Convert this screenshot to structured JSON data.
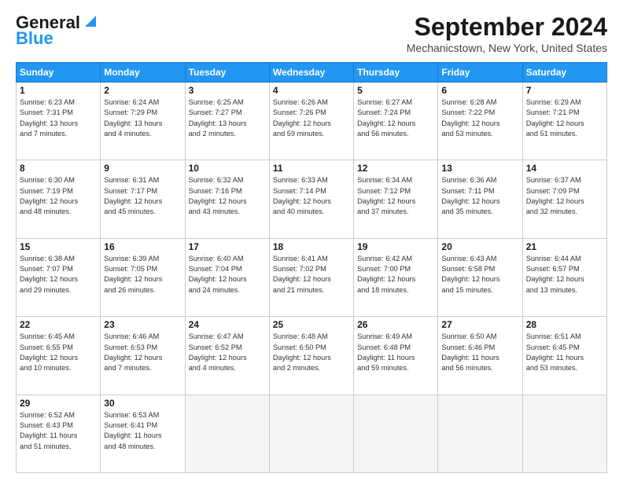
{
  "logo": {
    "line1": "General",
    "line2": "Blue"
  },
  "title": "September 2024",
  "subtitle": "Mechanicstown, New York, United States",
  "weekdays": [
    "Sunday",
    "Monday",
    "Tuesday",
    "Wednesday",
    "Thursday",
    "Friday",
    "Saturday"
  ],
  "weeks": [
    [
      {
        "day": "1",
        "info": "Sunrise: 6:23 AM\nSunset: 7:31 PM\nDaylight: 13 hours\nand 7 minutes."
      },
      {
        "day": "2",
        "info": "Sunrise: 6:24 AM\nSunset: 7:29 PM\nDaylight: 13 hours\nand 4 minutes."
      },
      {
        "day": "3",
        "info": "Sunrise: 6:25 AM\nSunset: 7:27 PM\nDaylight: 13 hours\nand 2 minutes."
      },
      {
        "day": "4",
        "info": "Sunrise: 6:26 AM\nSunset: 7:26 PM\nDaylight: 12 hours\nand 59 minutes."
      },
      {
        "day": "5",
        "info": "Sunrise: 6:27 AM\nSunset: 7:24 PM\nDaylight: 12 hours\nand 56 minutes."
      },
      {
        "day": "6",
        "info": "Sunrise: 6:28 AM\nSunset: 7:22 PM\nDaylight: 12 hours\nand 53 minutes."
      },
      {
        "day": "7",
        "info": "Sunrise: 6:29 AM\nSunset: 7:21 PM\nDaylight: 12 hours\nand 51 minutes."
      }
    ],
    [
      {
        "day": "8",
        "info": "Sunrise: 6:30 AM\nSunset: 7:19 PM\nDaylight: 12 hours\nand 48 minutes."
      },
      {
        "day": "9",
        "info": "Sunrise: 6:31 AM\nSunset: 7:17 PM\nDaylight: 12 hours\nand 45 minutes."
      },
      {
        "day": "10",
        "info": "Sunrise: 6:32 AM\nSunset: 7:16 PM\nDaylight: 12 hours\nand 43 minutes."
      },
      {
        "day": "11",
        "info": "Sunrise: 6:33 AM\nSunset: 7:14 PM\nDaylight: 12 hours\nand 40 minutes."
      },
      {
        "day": "12",
        "info": "Sunrise: 6:34 AM\nSunset: 7:12 PM\nDaylight: 12 hours\nand 37 minutes."
      },
      {
        "day": "13",
        "info": "Sunrise: 6:36 AM\nSunset: 7:11 PM\nDaylight: 12 hours\nand 35 minutes."
      },
      {
        "day": "14",
        "info": "Sunrise: 6:37 AM\nSunset: 7:09 PM\nDaylight: 12 hours\nand 32 minutes."
      }
    ],
    [
      {
        "day": "15",
        "info": "Sunrise: 6:38 AM\nSunset: 7:07 PM\nDaylight: 12 hours\nand 29 minutes."
      },
      {
        "day": "16",
        "info": "Sunrise: 6:39 AM\nSunset: 7:05 PM\nDaylight: 12 hours\nand 26 minutes."
      },
      {
        "day": "17",
        "info": "Sunrise: 6:40 AM\nSunset: 7:04 PM\nDaylight: 12 hours\nand 24 minutes."
      },
      {
        "day": "18",
        "info": "Sunrise: 6:41 AM\nSunset: 7:02 PM\nDaylight: 12 hours\nand 21 minutes."
      },
      {
        "day": "19",
        "info": "Sunrise: 6:42 AM\nSunset: 7:00 PM\nDaylight: 12 hours\nand 18 minutes."
      },
      {
        "day": "20",
        "info": "Sunrise: 6:43 AM\nSunset: 6:58 PM\nDaylight: 12 hours\nand 15 minutes."
      },
      {
        "day": "21",
        "info": "Sunrise: 6:44 AM\nSunset: 6:57 PM\nDaylight: 12 hours\nand 13 minutes."
      }
    ],
    [
      {
        "day": "22",
        "info": "Sunrise: 6:45 AM\nSunset: 6:55 PM\nDaylight: 12 hours\nand 10 minutes."
      },
      {
        "day": "23",
        "info": "Sunrise: 6:46 AM\nSunset: 6:53 PM\nDaylight: 12 hours\nand 7 minutes."
      },
      {
        "day": "24",
        "info": "Sunrise: 6:47 AM\nSunset: 6:52 PM\nDaylight: 12 hours\nand 4 minutes."
      },
      {
        "day": "25",
        "info": "Sunrise: 6:48 AM\nSunset: 6:50 PM\nDaylight: 12 hours\nand 2 minutes."
      },
      {
        "day": "26",
        "info": "Sunrise: 6:49 AM\nSunset: 6:48 PM\nDaylight: 11 hours\nand 59 minutes."
      },
      {
        "day": "27",
        "info": "Sunrise: 6:50 AM\nSunset: 6:46 PM\nDaylight: 11 hours\nand 56 minutes."
      },
      {
        "day": "28",
        "info": "Sunrise: 6:51 AM\nSunset: 6:45 PM\nDaylight: 11 hours\nand 53 minutes."
      }
    ],
    [
      {
        "day": "29",
        "info": "Sunrise: 6:52 AM\nSunset: 6:43 PM\nDaylight: 11 hours\nand 51 minutes."
      },
      {
        "day": "30",
        "info": "Sunrise: 6:53 AM\nSunset: 6:41 PM\nDaylight: 11 hours\nand 48 minutes."
      },
      {
        "day": "",
        "info": ""
      },
      {
        "day": "",
        "info": ""
      },
      {
        "day": "",
        "info": ""
      },
      {
        "day": "",
        "info": ""
      },
      {
        "day": "",
        "info": ""
      }
    ]
  ]
}
